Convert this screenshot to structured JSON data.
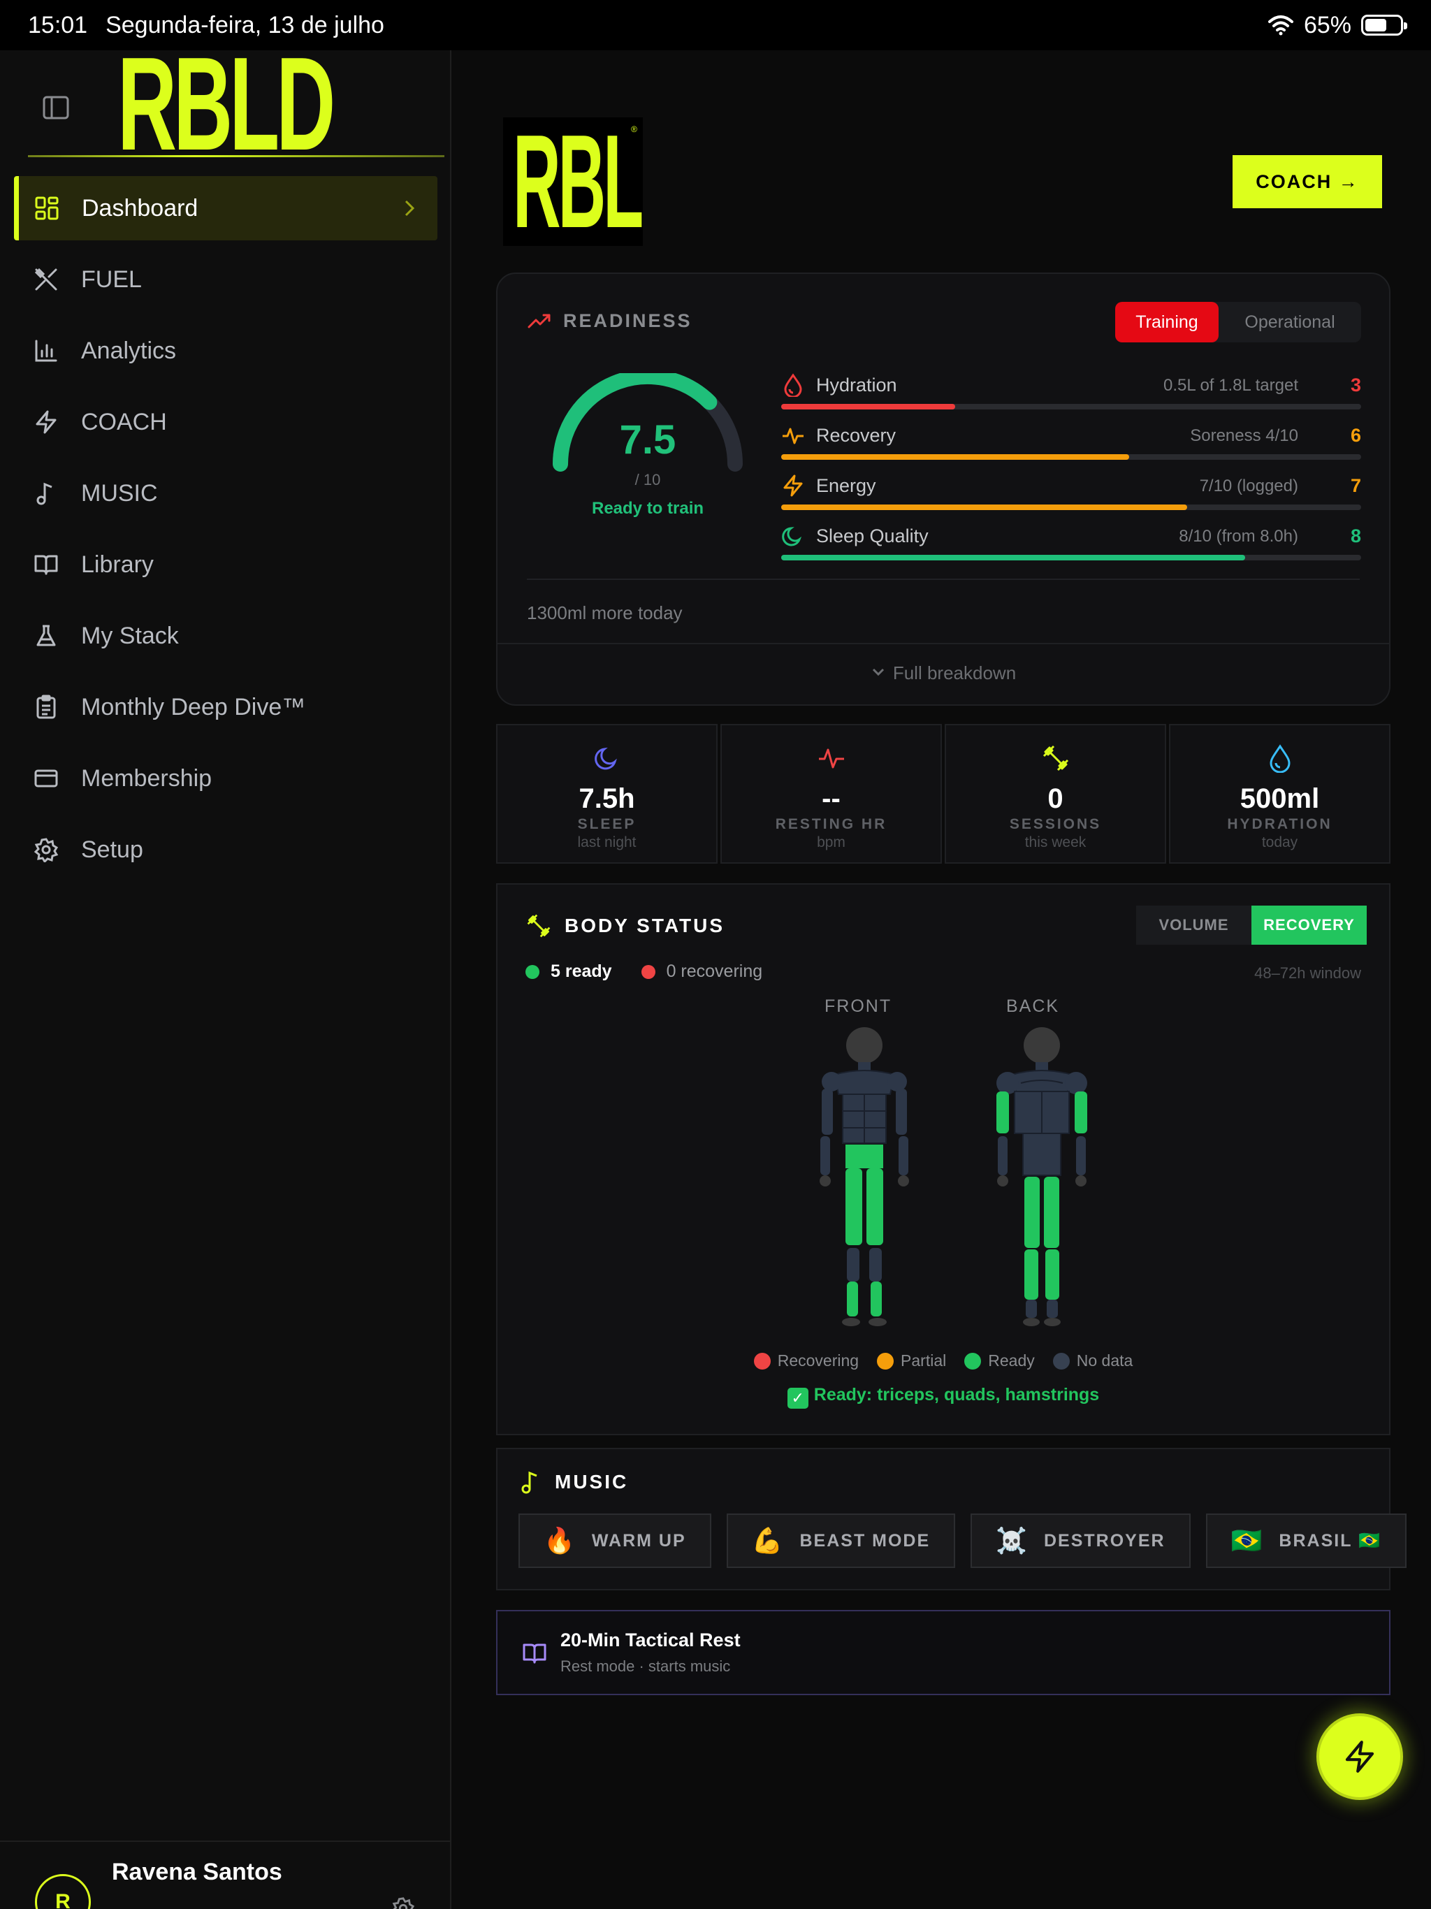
{
  "status_bar": {
    "time": "15:01",
    "date": "Segunda-feira, 13 de julho",
    "battery": "65%"
  },
  "brand": {
    "logo_text": "RBLD",
    "registered": "®"
  },
  "sidebar": {
    "items": [
      {
        "label": "Dashboard",
        "icon": "dashboard-icon",
        "active": true
      },
      {
        "label": "FUEL",
        "icon": "utensils-icon"
      },
      {
        "label": "Analytics",
        "icon": "bar-chart-icon"
      },
      {
        "label": "COACH",
        "icon": "bolt-icon"
      },
      {
        "label": "MUSIC",
        "icon": "music-note-icon"
      },
      {
        "label": "Library",
        "icon": "book-icon"
      },
      {
        "label": "My Stack",
        "icon": "flask-icon"
      },
      {
        "label": "Monthly Deep Dive™",
        "icon": "clipboard-icon"
      },
      {
        "label": "Membership",
        "icon": "credit-card-icon"
      },
      {
        "label": "Setup",
        "icon": "gear-icon"
      }
    ],
    "user": {
      "initial": "R",
      "name": "Ravena Santos"
    }
  },
  "header": {
    "coach_button": "COACH →"
  },
  "readiness": {
    "title": "READINESS",
    "modes": [
      "Training",
      "Operational"
    ],
    "selected_mode": "Training",
    "score": "7.5",
    "score_max": "/ 10",
    "score_value": 7.5,
    "score_scale": 10,
    "status": "Ready to train",
    "metrics": [
      {
        "name": "Hydration",
        "detail": "0.5L of 1.8L target",
        "score": "3",
        "percent": 30,
        "color": "#ef3b3b"
      },
      {
        "name": "Recovery",
        "detail": "Soreness 4/10",
        "score": "6",
        "percent": 60,
        "color": "#f59e0b"
      },
      {
        "name": "Energy",
        "detail": "7/10 (logged)",
        "score": "7",
        "percent": 70,
        "color": "#f59e0b"
      },
      {
        "name": "Sleep Quality",
        "detail": "8/10 (from 8.0h)",
        "score": "8",
        "percent": 80,
        "color": "#1fbf7a"
      }
    ],
    "note": "1300ml more today",
    "breakdown_label": "Full breakdown"
  },
  "stats": [
    {
      "value": "7.5h",
      "label": "SLEEP",
      "sub": "last night",
      "icon": "moon-icon",
      "color": "#6366f1"
    },
    {
      "value": "--",
      "label": "RESTING HR",
      "sub": "bpm",
      "icon": "heart-rate-icon",
      "color": "#ef4444"
    },
    {
      "value": "0",
      "label": "SESSIONS",
      "sub": "this week",
      "icon": "dumbbell-icon",
      "color": "#dcff1c"
    },
    {
      "value": "500ml",
      "label": "HYDRATION",
      "sub": "today",
      "icon": "droplet-icon",
      "color": "#38bdf8"
    }
  ],
  "body_status": {
    "title": "BODY STATUS",
    "modes": [
      "VOLUME",
      "RECOVERY"
    ],
    "selected_mode": "RECOVERY",
    "ready_count": "5 ready",
    "recovering_count": "0 recovering",
    "window": "48–72h window",
    "front_label": "FRONT",
    "back_label": "BACK",
    "legend": [
      {
        "label": "Recovering",
        "color": "#ef4444"
      },
      {
        "label": "Partial",
        "color": "#f59e0b"
      },
      {
        "label": "Ready",
        "color": "#22c55e"
      },
      {
        "label": "No data",
        "color": "#374151"
      }
    ],
    "ready_summary": "Ready: triceps, quads, hamstrings",
    "check_glyph": "✓"
  },
  "music": {
    "title": "MUSIC",
    "playlists": [
      {
        "emoji": "🔥",
        "label": "WARM UP"
      },
      {
        "emoji": "💪",
        "label": "BEAST MODE"
      },
      {
        "emoji": "☠️",
        "label": "DESTROYER"
      },
      {
        "emoji": "🇧🇷",
        "label": "BRASIL 🇧🇷"
      }
    ]
  },
  "rest": {
    "title": "20-Min Tactical Rest",
    "subtitle": "Rest mode · starts music"
  },
  "colors": {
    "accent": "#dcff1c",
    "ready": "#22c55e",
    "danger": "#e50914",
    "body_base": "#2d3748"
  }
}
